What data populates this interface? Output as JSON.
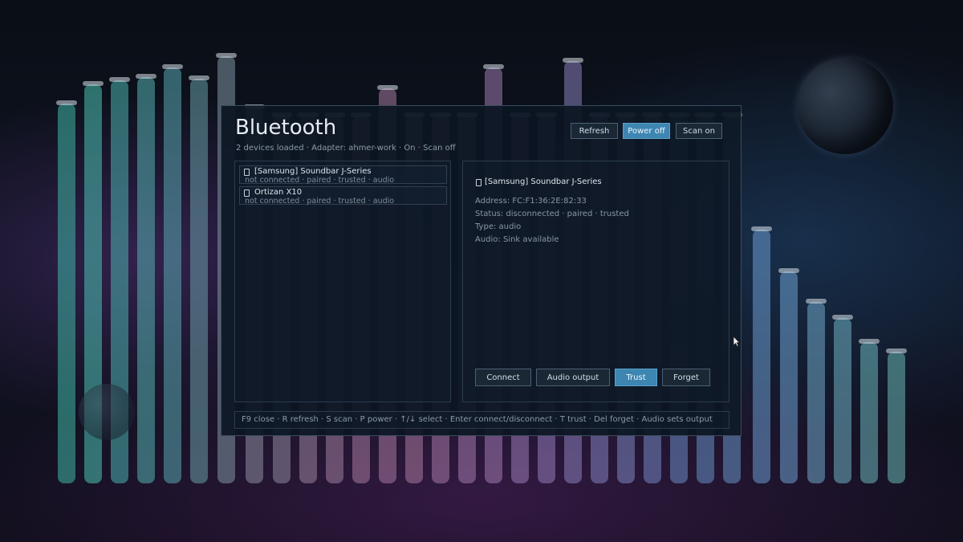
{
  "dialog": {
    "title": "Bluetooth",
    "subtitle": "2 devices loaded · Adapter: ahmer-work · On · Scan off",
    "buttons": {
      "refresh": "Refresh",
      "power": "Power off",
      "scan": "Scan on"
    }
  },
  "devices": [
    {
      "name": "[Samsung] Soundbar J-Series",
      "meta": "not connected · paired · trusted · audio",
      "icon": "device-icon"
    },
    {
      "name": "Ortizan X10",
      "meta": "not connected · paired · trusted · audio",
      "icon": "device-icon"
    }
  ],
  "detail": {
    "title": "[Samsung] Soundbar J-Series",
    "address": "Address: FC:F1:36:2E:82:33",
    "status": "Status: disconnected · paired · trusted",
    "type": "Type: audio",
    "audio": "Audio: Sink available",
    "actions": {
      "connect": "Connect",
      "audio_output": "Audio output",
      "trust": "Trust",
      "forget": "Forget"
    }
  },
  "footer": {
    "hints": "F9 close · R refresh · S scan · P power · ↑/↓ select · Enter connect/disconnect · T trust · Del forget · Audio sets output"
  },
  "colors": {
    "accent": "#3e86b2",
    "panel_bg": "#0c1622",
    "text": "#e6ecf2",
    "muted": "#8d9aa7"
  }
}
